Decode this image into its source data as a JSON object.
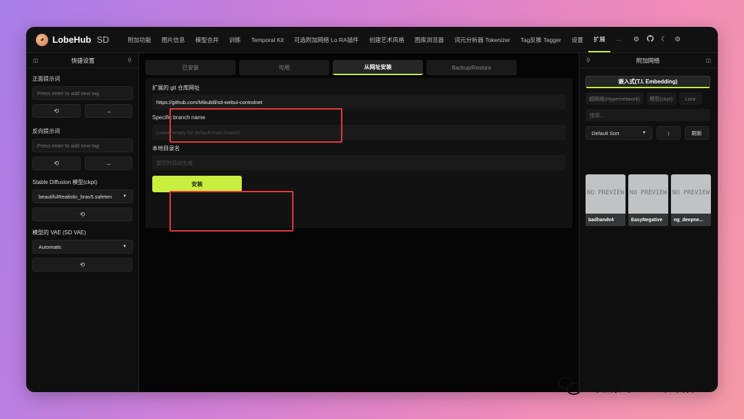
{
  "brand": {
    "name": "LobeHub",
    "suffix": "SD",
    "logo_icon": "avatar-emoji-icon"
  },
  "nav": {
    "items": [
      "附加功能",
      "图片信息",
      "模型合并",
      "训练",
      "Temporal Kit",
      "可选附加网络 Lo RA插件",
      "创建艺术风格",
      "图库浏览器",
      "词元分析器 Tokenizer",
      "Tag反推 Tagger",
      "设置",
      "扩展"
    ],
    "active": "扩展",
    "more": "···",
    "icons": [
      "settings-gear-icon",
      "github-icon",
      "moon-theme-icon",
      "settings-cog-icon"
    ]
  },
  "left": {
    "title": "快捷设置",
    "positive_label": "正面提示词",
    "positive_placeholder": "Press enter to add new tag",
    "negative_label": "反向提示词",
    "negative_placeholder": "Press enter to add new tag",
    "refresh_glyph": "⟲",
    "send_glyph": "→",
    "model_label": "Stable Diffusion 模型(ckpt)",
    "model_value": "beautifulRealistic_brav5.safeten",
    "vae_label": "模型的 VAE (SD VAE)",
    "vae_value": "Automatic"
  },
  "main": {
    "tabs": [
      "已安装",
      "可用",
      "从网址安装",
      "Backup/Restore"
    ],
    "active_tab": "从网址安装",
    "repo_label": "扩展的 git 仓库网址",
    "repo_value": "https://github.com/Mikubill/sd-webui-controlnet",
    "branch_label": "Specific branch name",
    "branch_placeholder": "Leave empty for default main branch",
    "dir_label": "本地目录名",
    "dir_placeholder": "留空时自动生成",
    "install_label": "安装"
  },
  "right": {
    "title": "附加网络",
    "embedding_label": "嵌入式(T.I. Embedding)",
    "sub_tabs": [
      "超网络(Hypernetwork)",
      "模型(ckpt)",
      "Lora"
    ],
    "search_placeholder": "搜索...",
    "sort_value": "Default Sort",
    "sort_dir_glyph": "↕",
    "refresh_label": "刷新",
    "cards": [
      {
        "preview": "NO PREVIEW",
        "name": "badhandv4"
      },
      {
        "preview": "NO PREVIEW",
        "name": "EasyNegative"
      },
      {
        "preview": "NO PREVIEW",
        "name": "ng_deepne..."
      }
    ]
  },
  "watermark": {
    "text": "歸藏的AI工具箱",
    "icon": "wechat-icon"
  },
  "colors": {
    "accent": "#c6ef3e",
    "highlight": "#e83a3a"
  }
}
